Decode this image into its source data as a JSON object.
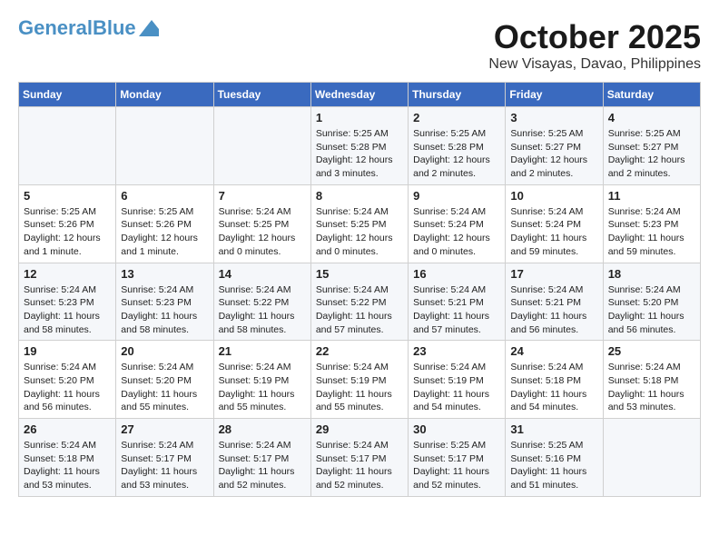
{
  "header": {
    "logo_line1": "General",
    "logo_line2": "Blue",
    "month": "October 2025",
    "location": "New Visayas, Davao, Philippines"
  },
  "weekdays": [
    "Sunday",
    "Monday",
    "Tuesday",
    "Wednesday",
    "Thursday",
    "Friday",
    "Saturday"
  ],
  "weeks": [
    [
      {
        "day": "",
        "info": ""
      },
      {
        "day": "",
        "info": ""
      },
      {
        "day": "",
        "info": ""
      },
      {
        "day": "1",
        "info": "Sunrise: 5:25 AM\nSunset: 5:28 PM\nDaylight: 12 hours\nand 3 minutes."
      },
      {
        "day": "2",
        "info": "Sunrise: 5:25 AM\nSunset: 5:28 PM\nDaylight: 12 hours\nand 2 minutes."
      },
      {
        "day": "3",
        "info": "Sunrise: 5:25 AM\nSunset: 5:27 PM\nDaylight: 12 hours\nand 2 minutes."
      },
      {
        "day": "4",
        "info": "Sunrise: 5:25 AM\nSunset: 5:27 PM\nDaylight: 12 hours\nand 2 minutes."
      }
    ],
    [
      {
        "day": "5",
        "info": "Sunrise: 5:25 AM\nSunset: 5:26 PM\nDaylight: 12 hours\nand 1 minute."
      },
      {
        "day": "6",
        "info": "Sunrise: 5:25 AM\nSunset: 5:26 PM\nDaylight: 12 hours\nand 1 minute."
      },
      {
        "day": "7",
        "info": "Sunrise: 5:24 AM\nSunset: 5:25 PM\nDaylight: 12 hours\nand 0 minutes."
      },
      {
        "day": "8",
        "info": "Sunrise: 5:24 AM\nSunset: 5:25 PM\nDaylight: 12 hours\nand 0 minutes."
      },
      {
        "day": "9",
        "info": "Sunrise: 5:24 AM\nSunset: 5:24 PM\nDaylight: 12 hours\nand 0 minutes."
      },
      {
        "day": "10",
        "info": "Sunrise: 5:24 AM\nSunset: 5:24 PM\nDaylight: 11 hours\nand 59 minutes."
      },
      {
        "day": "11",
        "info": "Sunrise: 5:24 AM\nSunset: 5:23 PM\nDaylight: 11 hours\nand 59 minutes."
      }
    ],
    [
      {
        "day": "12",
        "info": "Sunrise: 5:24 AM\nSunset: 5:23 PM\nDaylight: 11 hours\nand 58 minutes."
      },
      {
        "day": "13",
        "info": "Sunrise: 5:24 AM\nSunset: 5:23 PM\nDaylight: 11 hours\nand 58 minutes."
      },
      {
        "day": "14",
        "info": "Sunrise: 5:24 AM\nSunset: 5:22 PM\nDaylight: 11 hours\nand 58 minutes."
      },
      {
        "day": "15",
        "info": "Sunrise: 5:24 AM\nSunset: 5:22 PM\nDaylight: 11 hours\nand 57 minutes."
      },
      {
        "day": "16",
        "info": "Sunrise: 5:24 AM\nSunset: 5:21 PM\nDaylight: 11 hours\nand 57 minutes."
      },
      {
        "day": "17",
        "info": "Sunrise: 5:24 AM\nSunset: 5:21 PM\nDaylight: 11 hours\nand 56 minutes."
      },
      {
        "day": "18",
        "info": "Sunrise: 5:24 AM\nSunset: 5:20 PM\nDaylight: 11 hours\nand 56 minutes."
      }
    ],
    [
      {
        "day": "19",
        "info": "Sunrise: 5:24 AM\nSunset: 5:20 PM\nDaylight: 11 hours\nand 56 minutes."
      },
      {
        "day": "20",
        "info": "Sunrise: 5:24 AM\nSunset: 5:20 PM\nDaylight: 11 hours\nand 55 minutes."
      },
      {
        "day": "21",
        "info": "Sunrise: 5:24 AM\nSunset: 5:19 PM\nDaylight: 11 hours\nand 55 minutes."
      },
      {
        "day": "22",
        "info": "Sunrise: 5:24 AM\nSunset: 5:19 PM\nDaylight: 11 hours\nand 55 minutes."
      },
      {
        "day": "23",
        "info": "Sunrise: 5:24 AM\nSunset: 5:19 PM\nDaylight: 11 hours\nand 54 minutes."
      },
      {
        "day": "24",
        "info": "Sunrise: 5:24 AM\nSunset: 5:18 PM\nDaylight: 11 hours\nand 54 minutes."
      },
      {
        "day": "25",
        "info": "Sunrise: 5:24 AM\nSunset: 5:18 PM\nDaylight: 11 hours\nand 53 minutes."
      }
    ],
    [
      {
        "day": "26",
        "info": "Sunrise: 5:24 AM\nSunset: 5:18 PM\nDaylight: 11 hours\nand 53 minutes."
      },
      {
        "day": "27",
        "info": "Sunrise: 5:24 AM\nSunset: 5:17 PM\nDaylight: 11 hours\nand 53 minutes."
      },
      {
        "day": "28",
        "info": "Sunrise: 5:24 AM\nSunset: 5:17 PM\nDaylight: 11 hours\nand 52 minutes."
      },
      {
        "day": "29",
        "info": "Sunrise: 5:24 AM\nSunset: 5:17 PM\nDaylight: 11 hours\nand 52 minutes."
      },
      {
        "day": "30",
        "info": "Sunrise: 5:25 AM\nSunset: 5:17 PM\nDaylight: 11 hours\nand 52 minutes."
      },
      {
        "day": "31",
        "info": "Sunrise: 5:25 AM\nSunset: 5:16 PM\nDaylight: 11 hours\nand 51 minutes."
      },
      {
        "day": "",
        "info": ""
      }
    ]
  ]
}
